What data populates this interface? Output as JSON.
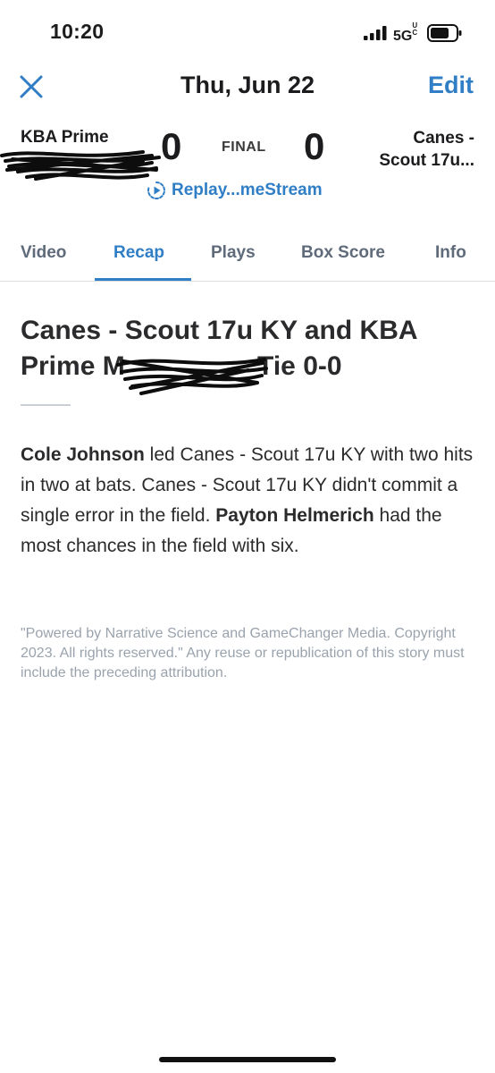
{
  "status_bar": {
    "time": "10:20",
    "network": "5G",
    "network_sup": "UC"
  },
  "header": {
    "date": "Thu, Jun 22",
    "edit_label": "Edit"
  },
  "scoreboard": {
    "home_team": "KBA Prime",
    "home_score": "0",
    "status": "FINAL",
    "away_score": "0",
    "away_team_line1": "Canes -",
    "away_team_line2": "Scout 17u...",
    "replay_label": "Replay...meStream"
  },
  "tabs": [
    {
      "label": "Video"
    },
    {
      "label": "Recap"
    },
    {
      "label": "Plays"
    },
    {
      "label": "Box Score"
    },
    {
      "label": "Info"
    }
  ],
  "active_tab": "Recap",
  "recap": {
    "headline_part1": "Canes - Scout 17u KY and KBA Prime M",
    "headline_part2": " Tie 0-0",
    "p_name1": "Cole Johnson",
    "p_text1": " led Canes - Scout 17u KY with two hits in two at bats.  Canes - Scout 17u KY didn't commit a single error in the field. ",
    "p_name2": "Payton Helmerich",
    "p_text2": " had the most chances in the field with six.",
    "attribution": "\"Powered by Narrative Science and GameChanger Media. Copyright 2023. All rights reserved.\" Any reuse or republication of this story must include the preceding attribution."
  },
  "colors": {
    "accent": "#2f7ec6",
    "text": "#1c1c1e",
    "muted": "#9aa3ad"
  },
  "icons": [
    "close-icon",
    "replay-icon",
    "signal-icon",
    "battery-icon"
  ]
}
